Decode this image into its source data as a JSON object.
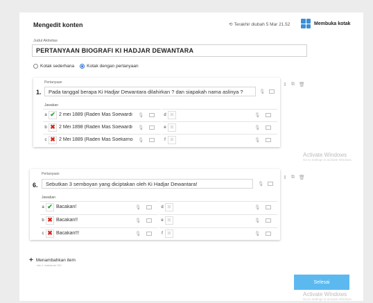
{
  "header": {
    "title": "Mengedit konten",
    "last_edited": "Terakhir diubah 5 Mar 21.52",
    "open_box": "Membuka kotak"
  },
  "activity": {
    "label": "Judul Aktivitas",
    "value": "PERTANYAAN BIOGRAFI KI HADJAR DEWANTARA"
  },
  "mode": {
    "options": [
      "Kotak sederhana",
      "Kotak dengan pertanyaan"
    ],
    "selected": "Kotak dengan pertanyaan"
  },
  "questions": [
    {
      "label": "Pertanyaan",
      "number": "1.",
      "text": "Pada tanggal berapa Ki Hadjar Dewantara dilahirkan ? dan siapakah nama aslinya ?",
      "answers_label": "Jawaban",
      "answers": [
        {
          "letter": "a",
          "state": "correct",
          "text": "2 mei 1889 (Raden Mas Soewardi"
        },
        {
          "letter": "b",
          "state": "wrong",
          "text": "2 Mei 1898 (Raden Mas Soewardi"
        },
        {
          "letter": "c",
          "state": "wrong",
          "text": "2 Mei 1889 (Raden Mas Soekarno"
        },
        {
          "letter": "d",
          "state": "empty",
          "text": ""
        },
        {
          "letter": "e",
          "state": "empty",
          "text": ""
        },
        {
          "letter": "f",
          "state": "empty",
          "text": ""
        }
      ]
    },
    {
      "label": "Pertanyaan",
      "number": "6.",
      "text": "Sebutkan 3 semboyan yang diciptakan oleh Ki Hadjar Dewantara!",
      "answers_label": "Jawaban",
      "answers": [
        {
          "letter": "a",
          "state": "correct",
          "text": "Bacakan!"
        },
        {
          "letter": "b",
          "state": "wrong",
          "text": "Bacakan!!"
        },
        {
          "letter": "c",
          "state": "wrong",
          "text": "Bacakan!!!"
        },
        {
          "letter": "d",
          "state": "empty",
          "text": ""
        },
        {
          "letter": "e",
          "state": "empty",
          "text": ""
        },
        {
          "letter": "f",
          "state": "empty",
          "text": ""
        }
      ]
    }
  ],
  "add_item": {
    "label": "Menambahkan item",
    "sub": "min 1   maksimal 100"
  },
  "submit_label": "Selesai",
  "watermark": {
    "title": "Activate Windows",
    "sub": "Go to Settings to activate Windows."
  },
  "colors": {
    "accent": "#5bb9f0",
    "correct": "#2e9d3a",
    "wrong": "#d8251e"
  }
}
